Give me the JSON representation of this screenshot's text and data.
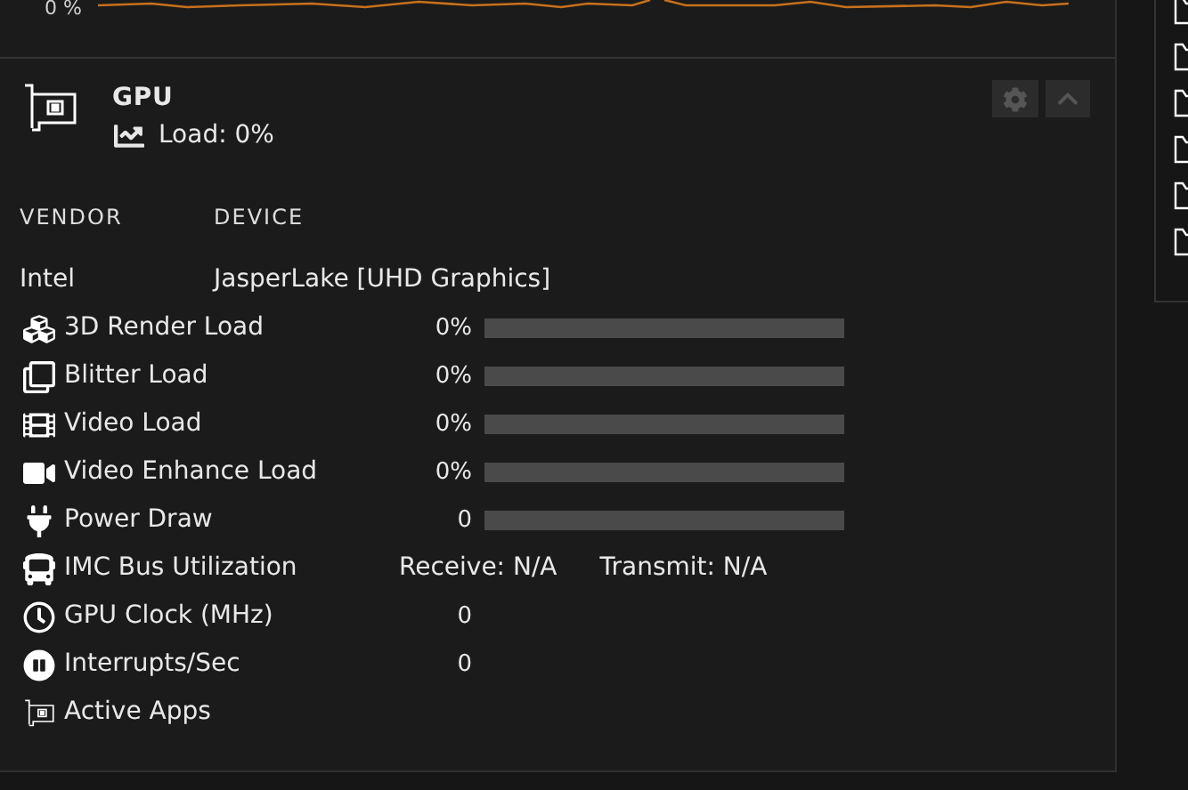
{
  "top_graph": {
    "axis_label": "0 %"
  },
  "gpu": {
    "title": "GPU",
    "load": "Load: 0%",
    "columns": [
      "VENDOR",
      "DEVICE"
    ],
    "vendor": "Intel",
    "device": "JasperLake [UHD Graphics]",
    "rows": [
      {
        "kind": "bar",
        "label": "3D Render Load",
        "value": "0%",
        "level": 0
      },
      {
        "kind": "bar",
        "label": "Blitter Load",
        "value": "0%",
        "level": 0
      },
      {
        "kind": "bar",
        "label": "Video Load",
        "value": "0%",
        "level": 0
      },
      {
        "kind": "bar",
        "label": "Video Enhance Load",
        "value": "0%",
        "level": 0
      },
      {
        "kind": "bar",
        "label": "Power Draw",
        "value": "0",
        "level": 0
      },
      {
        "kind": "rxtx",
        "label": "IMC Bus Utilization",
        "receive": "Receive: N/A",
        "transmit": "Transmit: N/A"
      },
      {
        "kind": "value",
        "label": "GPU Clock (MHz)",
        "value": "0"
      },
      {
        "kind": "value",
        "label": "Interrupts/Sec",
        "value": "0"
      },
      {
        "kind": "plain",
        "label": "Active Apps"
      }
    ]
  }
}
